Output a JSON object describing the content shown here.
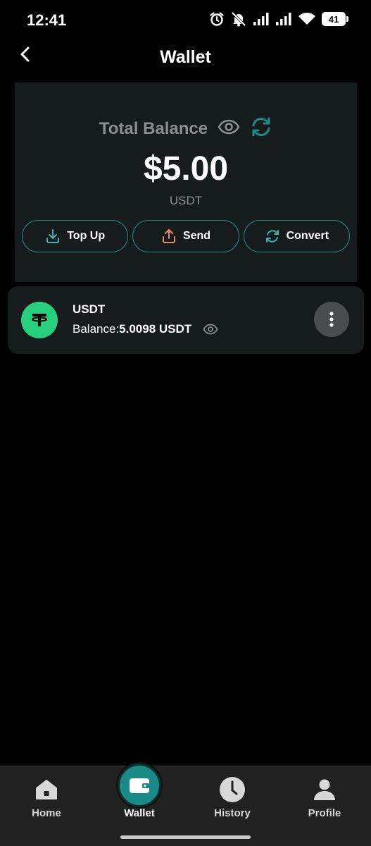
{
  "status_bar": {
    "time": "12:41",
    "battery": "41",
    "icons": [
      "alarm-icon",
      "mute-icon",
      "signal-icon",
      "signal-icon",
      "wifi-icon",
      "battery-icon"
    ]
  },
  "header": {
    "title": "Wallet",
    "back_icon": "chevron-left-icon"
  },
  "balance_card": {
    "label": "Total Balance",
    "amount": "$5.00",
    "currency": "USDT",
    "actions": [
      {
        "label": "Top Up",
        "icon": "download-icon"
      },
      {
        "label": "Send",
        "icon": "upload-icon"
      },
      {
        "label": "Convert",
        "icon": "refresh-icon"
      }
    ]
  },
  "asset": {
    "name": "USDT",
    "balance_label": "Balance:",
    "balance_value": "5.0098 USDT",
    "logo_icon": "tether-icon"
  },
  "bottom_nav": {
    "items": [
      {
        "label": "Home",
        "icon": "home-icon"
      },
      {
        "label": "Wallet",
        "icon": "wallet-icon",
        "active": true
      },
      {
        "label": "History",
        "icon": "clock-icon"
      },
      {
        "label": "Profile",
        "icon": "person-icon"
      }
    ]
  },
  "colors": {
    "background": "#000000",
    "card": "#161c1c",
    "accent": "#1e8a86",
    "tether_green": "#26d07c",
    "muted_text": "#8c8f91",
    "send_icon": "#e8897c",
    "nav_bg": "#212121"
  }
}
